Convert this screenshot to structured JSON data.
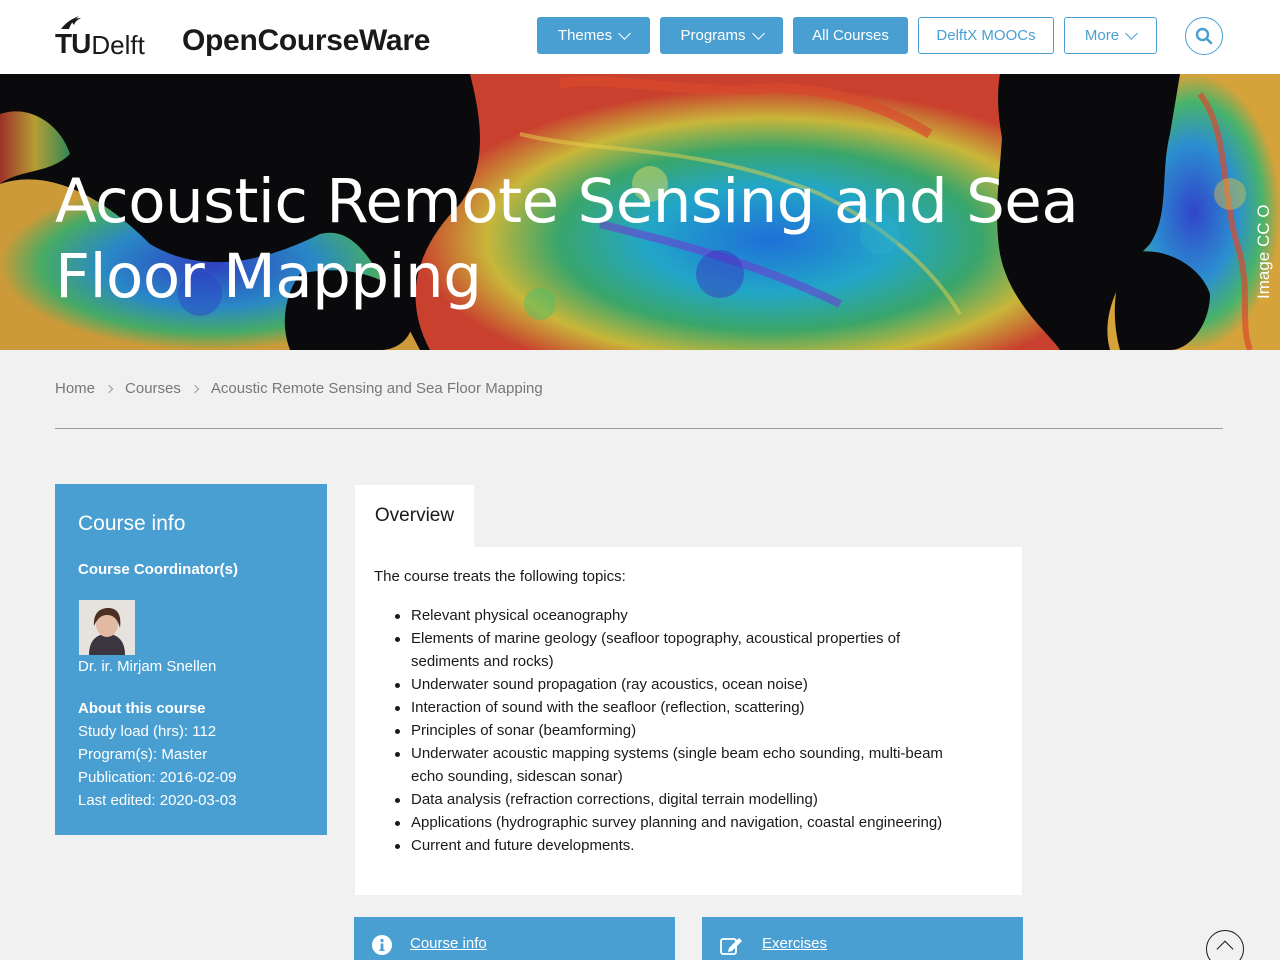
{
  "header": {
    "logo": {
      "tu": "TU",
      "delft": "Delft"
    },
    "site_title": "OpenCourseWare",
    "nav": [
      {
        "label": "Themes"
      },
      {
        "label": "Programs"
      },
      {
        "label": "All Courses"
      },
      {
        "label": "DelftX MOOCs"
      },
      {
        "label": "More"
      }
    ]
  },
  "hero": {
    "title": "Acoustic Remote Sensing and Sea Floor Mapping",
    "credit": "Image CC O"
  },
  "breadcrumb": [
    "Home",
    "Courses",
    "Acoustic Remote Sensing and Sea Floor Mapping"
  ],
  "sidebar": {
    "title": "Course info",
    "coordinator_heading": "Course Coordinator(s)",
    "coordinator_name": "Dr. ir. Mirjam Snellen",
    "about_heading": "About this course",
    "lines": [
      "Study load (hrs): 112",
      "Program(s): Master",
      "Publication: 2016-02-09",
      "Last edited: 2020-03-03"
    ]
  },
  "tab": {
    "label": "Overview"
  },
  "overview": {
    "intro": "The course treats the following topics:",
    "topics": [
      "Relevant physical oceanography",
      "Elements of marine geology (seafloor topography, acoustical properties of sediments and rocks)",
      "Underwater sound propagation (ray acoustics, ocean noise)",
      "Interaction of sound with the seafloor (reflection, scattering)",
      "Principles of sonar (beamforming)",
      "Underwater acoustic mapping systems (single beam echo sounding, multi-beam echo sounding, sidescan sonar)",
      "Data analysis (refraction corrections, digital terrain modelling)",
      "Applications (hydrographic survey planning and navigation, coastal engineering)",
      "Current and future developments."
    ]
  },
  "cards": [
    {
      "label": "Course info",
      "icon": "info-icon"
    },
    {
      "label": "Exercises",
      "icon": "edit-icon"
    }
  ],
  "colors": {
    "accent": "#4a9fd2",
    "background": "#f1f1f1"
  }
}
